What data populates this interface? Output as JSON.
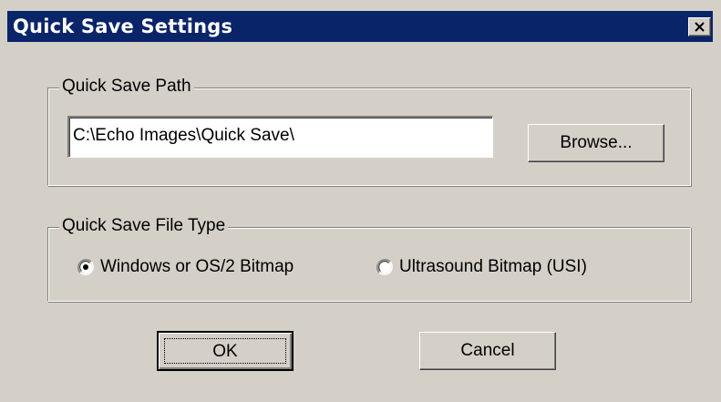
{
  "window": {
    "title": "Quick Save Settings"
  },
  "path_group": {
    "label": "Quick Save Path",
    "path_value": "C:\\Echo Images\\Quick Save\\",
    "browse_label": "Browse..."
  },
  "type_group": {
    "label": "Quick Save File Type",
    "options": [
      {
        "label": "Windows or OS/2 Bitmap",
        "selected": true
      },
      {
        "label": "Ultrasound Bitmap (USI)",
        "selected": false
      }
    ]
  },
  "buttons": {
    "ok_label": "OK",
    "cancel_label": "Cancel"
  },
  "icons": {
    "close": "close-icon"
  },
  "colors": {
    "titlebar": "#0a246a",
    "dialog_bg": "#d4d0c8"
  }
}
